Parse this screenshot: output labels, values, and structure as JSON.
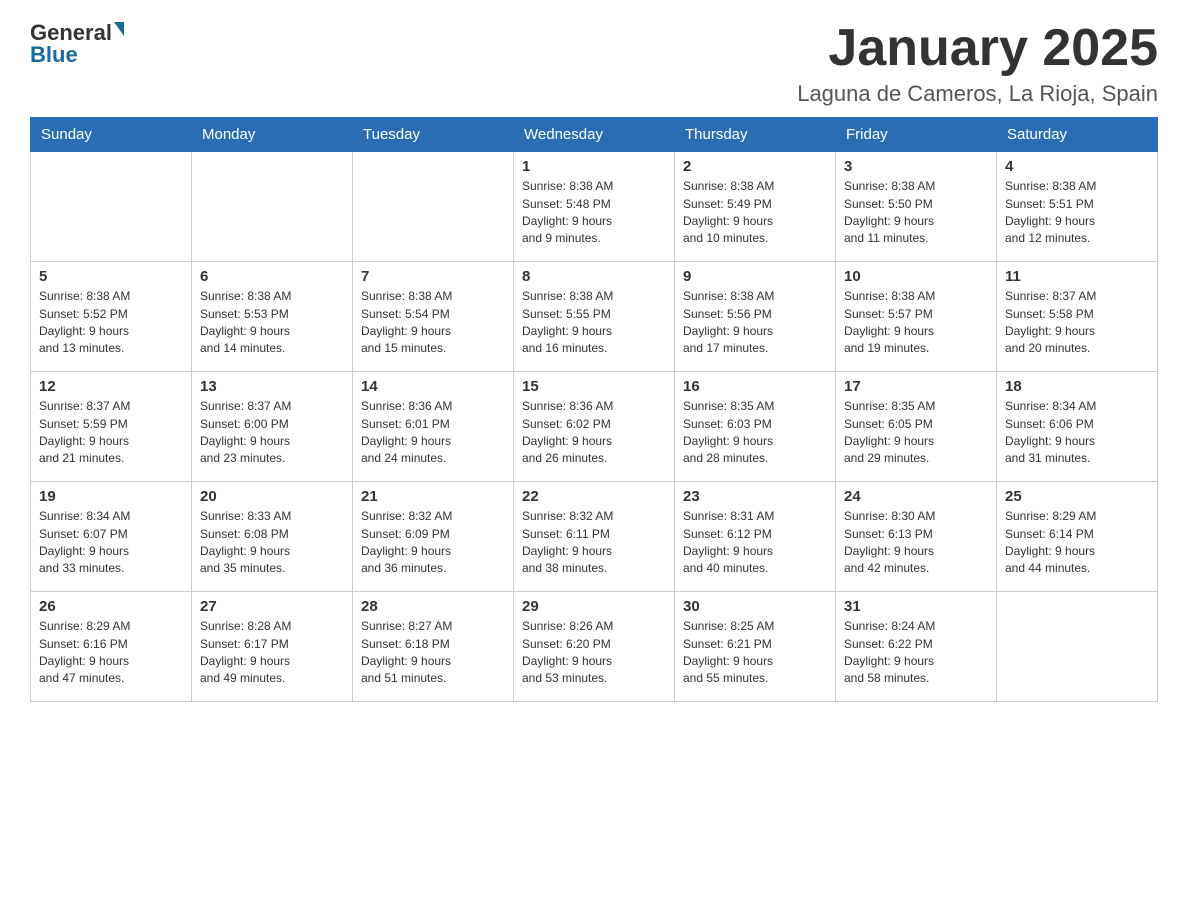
{
  "header": {
    "logo": {
      "general": "General",
      "blue": "Blue"
    },
    "month_title": "January 2025",
    "location": "Laguna de Cameros, La Rioja, Spain"
  },
  "weekdays": [
    "Sunday",
    "Monday",
    "Tuesday",
    "Wednesday",
    "Thursday",
    "Friday",
    "Saturday"
  ],
  "weeks": [
    [
      {
        "day": "",
        "info": ""
      },
      {
        "day": "",
        "info": ""
      },
      {
        "day": "",
        "info": ""
      },
      {
        "day": "1",
        "info": "Sunrise: 8:38 AM\nSunset: 5:48 PM\nDaylight: 9 hours\nand 9 minutes."
      },
      {
        "day": "2",
        "info": "Sunrise: 8:38 AM\nSunset: 5:49 PM\nDaylight: 9 hours\nand 10 minutes."
      },
      {
        "day": "3",
        "info": "Sunrise: 8:38 AM\nSunset: 5:50 PM\nDaylight: 9 hours\nand 11 minutes."
      },
      {
        "day": "4",
        "info": "Sunrise: 8:38 AM\nSunset: 5:51 PM\nDaylight: 9 hours\nand 12 minutes."
      }
    ],
    [
      {
        "day": "5",
        "info": "Sunrise: 8:38 AM\nSunset: 5:52 PM\nDaylight: 9 hours\nand 13 minutes."
      },
      {
        "day": "6",
        "info": "Sunrise: 8:38 AM\nSunset: 5:53 PM\nDaylight: 9 hours\nand 14 minutes."
      },
      {
        "day": "7",
        "info": "Sunrise: 8:38 AM\nSunset: 5:54 PM\nDaylight: 9 hours\nand 15 minutes."
      },
      {
        "day": "8",
        "info": "Sunrise: 8:38 AM\nSunset: 5:55 PM\nDaylight: 9 hours\nand 16 minutes."
      },
      {
        "day": "9",
        "info": "Sunrise: 8:38 AM\nSunset: 5:56 PM\nDaylight: 9 hours\nand 17 minutes."
      },
      {
        "day": "10",
        "info": "Sunrise: 8:38 AM\nSunset: 5:57 PM\nDaylight: 9 hours\nand 19 minutes."
      },
      {
        "day": "11",
        "info": "Sunrise: 8:37 AM\nSunset: 5:58 PM\nDaylight: 9 hours\nand 20 minutes."
      }
    ],
    [
      {
        "day": "12",
        "info": "Sunrise: 8:37 AM\nSunset: 5:59 PM\nDaylight: 9 hours\nand 21 minutes."
      },
      {
        "day": "13",
        "info": "Sunrise: 8:37 AM\nSunset: 6:00 PM\nDaylight: 9 hours\nand 23 minutes."
      },
      {
        "day": "14",
        "info": "Sunrise: 8:36 AM\nSunset: 6:01 PM\nDaylight: 9 hours\nand 24 minutes."
      },
      {
        "day": "15",
        "info": "Sunrise: 8:36 AM\nSunset: 6:02 PM\nDaylight: 9 hours\nand 26 minutes."
      },
      {
        "day": "16",
        "info": "Sunrise: 8:35 AM\nSunset: 6:03 PM\nDaylight: 9 hours\nand 28 minutes."
      },
      {
        "day": "17",
        "info": "Sunrise: 8:35 AM\nSunset: 6:05 PM\nDaylight: 9 hours\nand 29 minutes."
      },
      {
        "day": "18",
        "info": "Sunrise: 8:34 AM\nSunset: 6:06 PM\nDaylight: 9 hours\nand 31 minutes."
      }
    ],
    [
      {
        "day": "19",
        "info": "Sunrise: 8:34 AM\nSunset: 6:07 PM\nDaylight: 9 hours\nand 33 minutes."
      },
      {
        "day": "20",
        "info": "Sunrise: 8:33 AM\nSunset: 6:08 PM\nDaylight: 9 hours\nand 35 minutes."
      },
      {
        "day": "21",
        "info": "Sunrise: 8:32 AM\nSunset: 6:09 PM\nDaylight: 9 hours\nand 36 minutes."
      },
      {
        "day": "22",
        "info": "Sunrise: 8:32 AM\nSunset: 6:11 PM\nDaylight: 9 hours\nand 38 minutes."
      },
      {
        "day": "23",
        "info": "Sunrise: 8:31 AM\nSunset: 6:12 PM\nDaylight: 9 hours\nand 40 minutes."
      },
      {
        "day": "24",
        "info": "Sunrise: 8:30 AM\nSunset: 6:13 PM\nDaylight: 9 hours\nand 42 minutes."
      },
      {
        "day": "25",
        "info": "Sunrise: 8:29 AM\nSunset: 6:14 PM\nDaylight: 9 hours\nand 44 minutes."
      }
    ],
    [
      {
        "day": "26",
        "info": "Sunrise: 8:29 AM\nSunset: 6:16 PM\nDaylight: 9 hours\nand 47 minutes."
      },
      {
        "day": "27",
        "info": "Sunrise: 8:28 AM\nSunset: 6:17 PM\nDaylight: 9 hours\nand 49 minutes."
      },
      {
        "day": "28",
        "info": "Sunrise: 8:27 AM\nSunset: 6:18 PM\nDaylight: 9 hours\nand 51 minutes."
      },
      {
        "day": "29",
        "info": "Sunrise: 8:26 AM\nSunset: 6:20 PM\nDaylight: 9 hours\nand 53 minutes."
      },
      {
        "day": "30",
        "info": "Sunrise: 8:25 AM\nSunset: 6:21 PM\nDaylight: 9 hours\nand 55 minutes."
      },
      {
        "day": "31",
        "info": "Sunrise: 8:24 AM\nSunset: 6:22 PM\nDaylight: 9 hours\nand 58 minutes."
      },
      {
        "day": "",
        "info": ""
      }
    ]
  ]
}
